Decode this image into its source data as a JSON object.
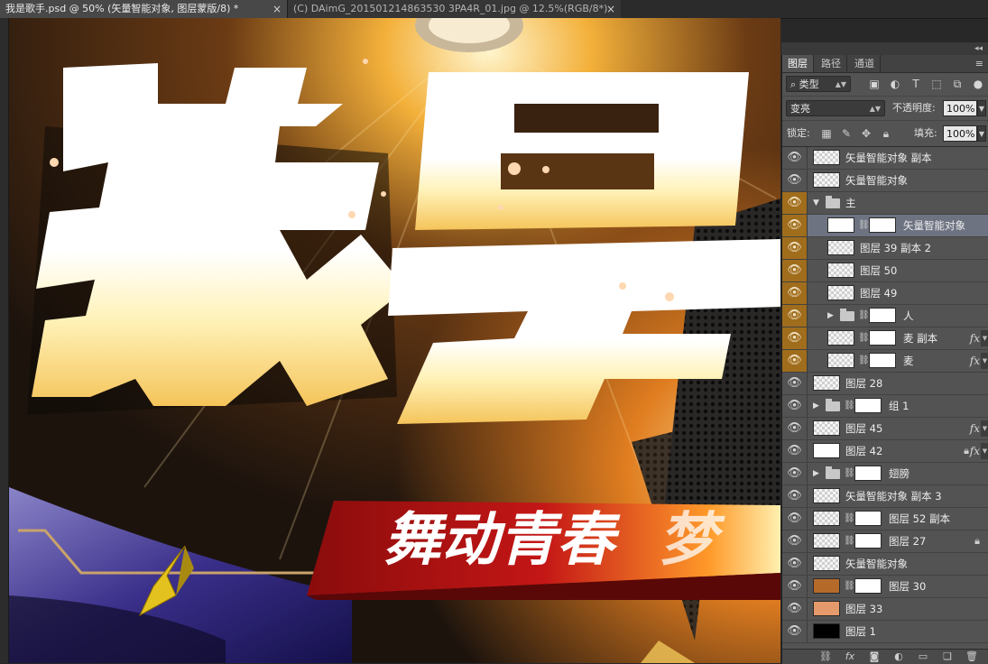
{
  "tabs": [
    {
      "label": "我是歌手.psd @ 50% (矢量智能对象, 图层蒙版/8) *",
      "close": "×"
    },
    {
      "label": "(C) DAimG_201501214863530 3PA4R_01.jpg @ 12.5%(RGB/8*)",
      "close": "×"
    }
  ],
  "canvas": {
    "title_text": "我是",
    "banner_text": "舞动青春",
    "banner_extra": "梦"
  },
  "panel": {
    "tabs": [
      "图层",
      "路径",
      "通道"
    ],
    "menu_icon": "≡",
    "filter": {
      "label": "类型"
    },
    "blend": {
      "mode": "变亮",
      "opacity_label": "不透明度:",
      "opacity": "100%"
    },
    "lock": {
      "label": "锁定:",
      "fill_label": "填充:",
      "fill": "100%"
    }
  },
  "layers": [
    {
      "name": "矢量智能对象 副本",
      "indent": 0,
      "group": false
    },
    {
      "name": "矢量智能对象",
      "indent": 0,
      "group": false
    },
    {
      "name": "主",
      "indent": 0,
      "group": true,
      "open": true
    },
    {
      "name": "矢量智能对象",
      "indent": 1,
      "group": false,
      "mask": true,
      "selected": true
    },
    {
      "name": "图层 39 副本 2",
      "indent": 1,
      "group": false
    },
    {
      "name": "图层 50",
      "indent": 1,
      "group": false
    },
    {
      "name": "图层 49",
      "indent": 1,
      "group": false
    },
    {
      "name": "人",
      "indent": 1,
      "group": true,
      "open": false,
      "mask": true
    },
    {
      "name": "麦 副本",
      "indent": 1,
      "group": false,
      "mask": true,
      "fx": true
    },
    {
      "name": "麦",
      "indent": 1,
      "group": false,
      "mask": true,
      "fx": true
    },
    {
      "name": "图层 28",
      "indent": 0,
      "group": false
    },
    {
      "name": "组 1",
      "indent": 0,
      "group": true,
      "open": false,
      "mask": true
    },
    {
      "name": "图层 45",
      "indent": 0,
      "group": false,
      "fx": true
    },
    {
      "name": "图层 42",
      "indent": 0,
      "group": false,
      "fx": true,
      "locked": true
    },
    {
      "name": "翅膀",
      "indent": 0,
      "group": true,
      "open": false,
      "mask": true
    },
    {
      "name": "矢量智能对象 副本 3",
      "indent": 0,
      "group": false
    },
    {
      "name": "图层 52 副本",
      "indent": 0,
      "group": false,
      "mask": true
    },
    {
      "name": "图层 27",
      "indent": 0,
      "group": false,
      "mask": true,
      "locked": true
    },
    {
      "name": "矢量智能对象",
      "indent": 0,
      "group": false
    },
    {
      "name": "图层 30",
      "indent": 0,
      "group": false,
      "mask": true
    },
    {
      "name": "图层 33",
      "indent": 0,
      "group": false
    },
    {
      "name": "图层 1",
      "indent": 0,
      "group": false,
      "black": true
    }
  ],
  "bottom_icons": [
    "link-icon",
    "fx-icon",
    "mask-icon",
    "adjustment-icon",
    "folder-icon",
    "new-layer-icon",
    "trash-icon"
  ]
}
